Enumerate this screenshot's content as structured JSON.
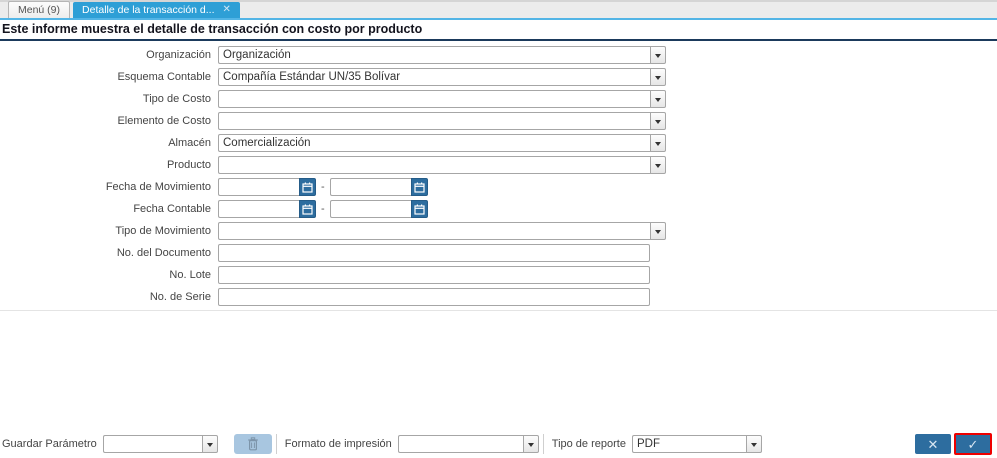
{
  "window": {
    "tabs": [
      {
        "label": "Menú (9)"
      },
      {
        "label": "Detalle de la transacción d...",
        "close_icon": "✕"
      }
    ],
    "title": "Este informe muestra el detalle de transacción con costo por producto"
  },
  "form": {
    "fields": [
      {
        "label": "Organización",
        "type": "combo",
        "value": "Organización"
      },
      {
        "label": "Esquema Contable",
        "type": "combo",
        "value": "Compañía Estándar UN/35 Bolívar"
      },
      {
        "label": "Tipo de Costo",
        "type": "combo",
        "value": ""
      },
      {
        "label": "Elemento de Costo",
        "type": "combo",
        "value": ""
      },
      {
        "label": "Almacén",
        "type": "combo",
        "value": "Comercialización"
      },
      {
        "label": "Producto",
        "type": "combo",
        "value": ""
      },
      {
        "label": "Fecha de Movimiento",
        "type": "daterange",
        "value_from": "",
        "value_to": "",
        "separator": "-"
      },
      {
        "label": "Fecha Contable",
        "type": "daterange",
        "value_from": "",
        "value_to": "",
        "separator": "-"
      },
      {
        "label": "Tipo de Movimiento",
        "type": "combo",
        "value": ""
      },
      {
        "label": "No. del Documento",
        "type": "text",
        "value": ""
      },
      {
        "label": "No. Lote",
        "type": "text",
        "value": ""
      },
      {
        "label": "No. de Serie",
        "type": "text",
        "value": ""
      }
    ]
  },
  "footer": {
    "save_param_label": "Guardar Parámetro",
    "save_param_value": "",
    "print_format_label": "Formato de impresión",
    "print_format_value": "",
    "report_type_label": "Tipo de reporte",
    "report_type_value": "PDF",
    "cancel_glyph": "✕",
    "ok_glyph": "✓"
  },
  "colors": {
    "active_tab_blue": "#2e9fd6",
    "tab_underline_blue": "#53b5e6",
    "title_rule_navy": "#1b3a5c",
    "action_button_blue": "#2d6d9f",
    "ok_highlight_red": "#ee0000",
    "trash_button_bg": "#a8c6e0"
  }
}
